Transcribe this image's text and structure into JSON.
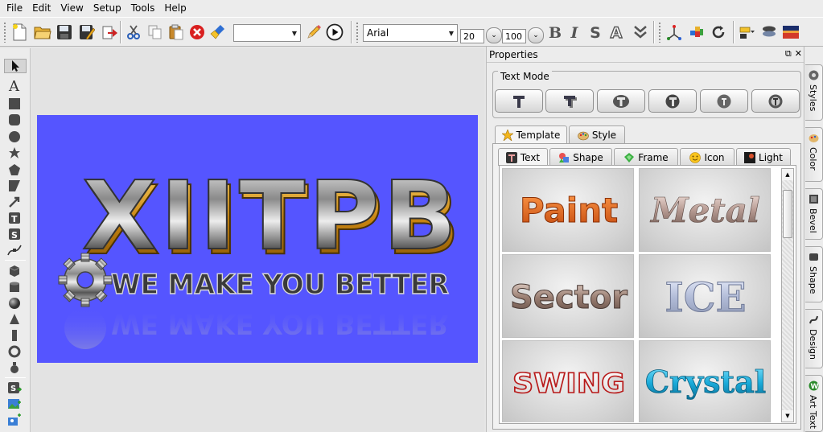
{
  "menubar": {
    "items": [
      "File",
      "Edit",
      "View",
      "Setup",
      "Tools",
      "Help"
    ]
  },
  "toolbar": {
    "style_combo_value": "",
    "font_name": "Arial",
    "font_size": "20",
    "scale": "100",
    "bold_label": "B",
    "italic_label": "I",
    "shadow_label": "S",
    "outline_label": "A"
  },
  "canvas": {
    "background_color": "#5555ff",
    "logo_text": "XIITPB",
    "slogan_text": "WE MAKE YOU BETTER"
  },
  "properties": {
    "title": "Properties",
    "text_mode": {
      "legend": "Text Mode",
      "buttons": [
        "mode-1",
        "mode-2",
        "mode-3",
        "mode-4",
        "mode-5",
        "mode-6"
      ]
    },
    "outer_tabs": [
      {
        "label": "Template",
        "icon": "star-icon",
        "active": true
      },
      {
        "label": "Style",
        "icon": "palette-icon",
        "active": false
      }
    ],
    "inner_tabs": [
      {
        "label": "Text",
        "icon": "text-icon",
        "active": true
      },
      {
        "label": "Shape",
        "icon": "shape-icon",
        "active": false
      },
      {
        "label": "Frame",
        "icon": "frame-icon",
        "active": false
      },
      {
        "label": "Icon",
        "icon": "smiley-icon",
        "active": false
      },
      {
        "label": "Light",
        "icon": "light-icon",
        "active": false
      }
    ],
    "templates": [
      "Paint",
      "Metal",
      "Sector",
      "ICE",
      "SWING",
      "Crystal"
    ]
  },
  "side_tabs": [
    "Styles",
    "Color",
    "Bevel",
    "Shape",
    "Design",
    "Art Text"
  ]
}
